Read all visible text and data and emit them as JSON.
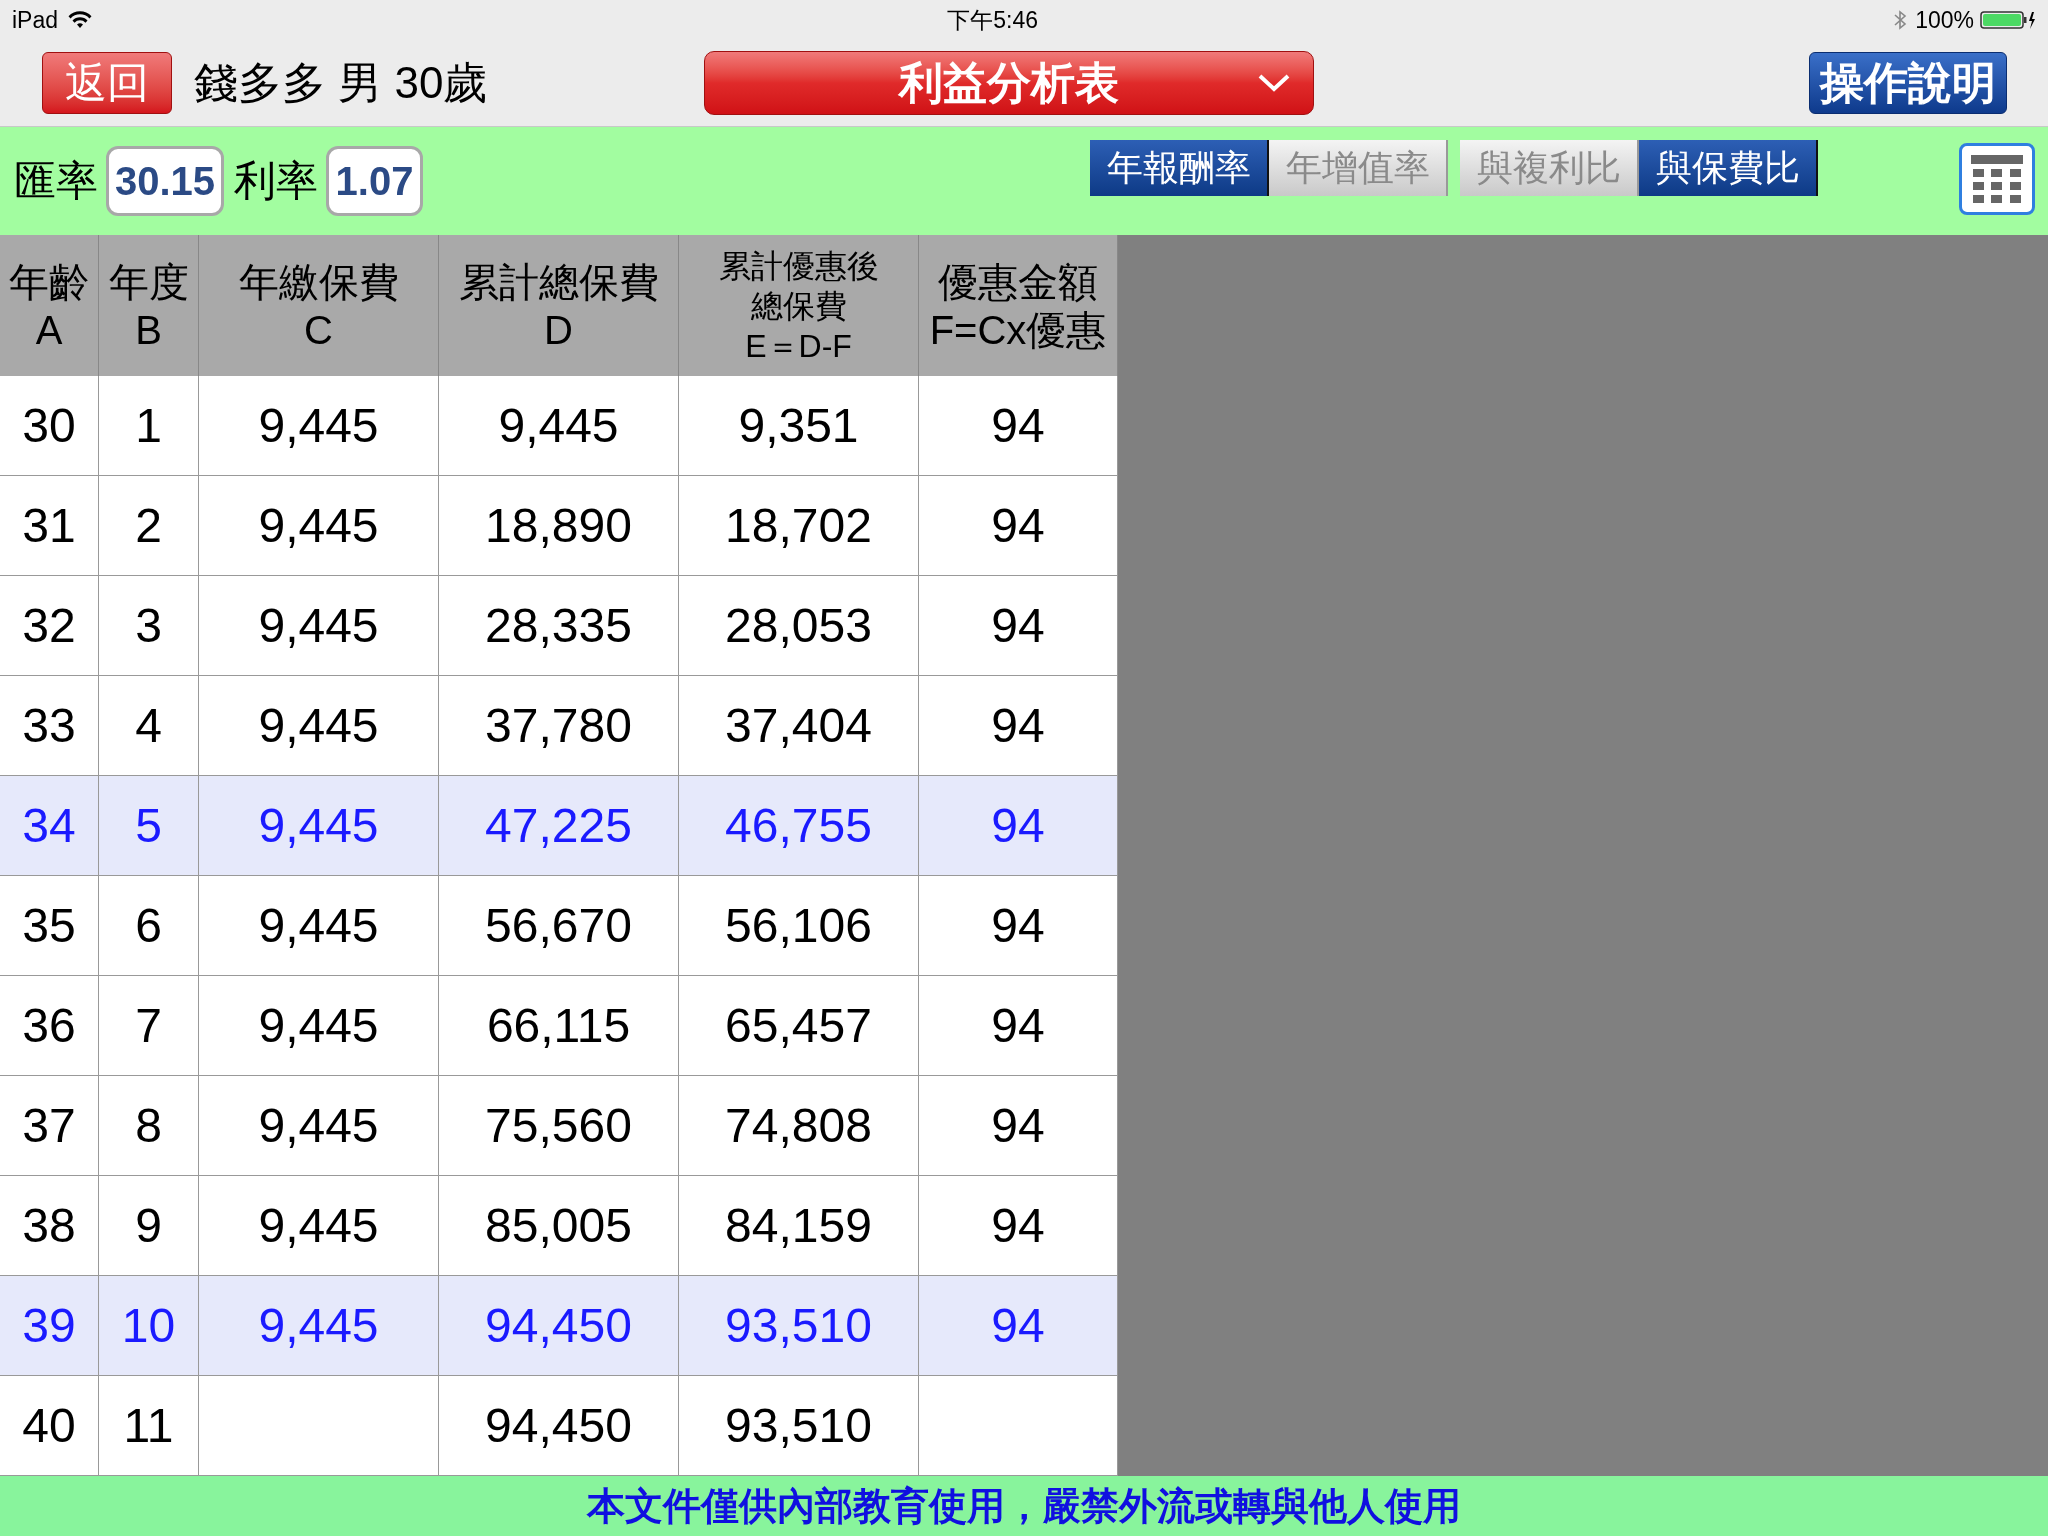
{
  "status_bar": {
    "device": "iPad",
    "time": "下午5:46",
    "battery": "100%"
  },
  "top_bar": {
    "back_button": "返回",
    "client": "錢多多 男 30歲",
    "report_dropdown": "利益分析表",
    "help_button": "操作說明"
  },
  "toolbar": {
    "exchange_rate_label": "匯率",
    "exchange_rate": "30.15",
    "interest_rate_label": "利率",
    "interest_rate": "1.07",
    "toggles": [
      {
        "label": "年報酬率",
        "selected": true
      },
      {
        "label": "年增值率",
        "selected": false
      },
      {
        "label": "與複利比",
        "selected": false
      },
      {
        "label": "與保費比",
        "selected": true
      }
    ]
  },
  "table": {
    "columns": [
      "年齡\nA",
      "年度\nB",
      "年繳保費\nC",
      "累計總保費\nD",
      "累計優惠後總保費\nE＝D-F",
      "優惠金額\nF=Cx優惠"
    ],
    "rows": [
      {
        "highlighted": false,
        "cells": [
          "30",
          "1",
          "9,445",
          "9,445",
          "9,351",
          "94"
        ]
      },
      {
        "highlighted": false,
        "cells": [
          "31",
          "2",
          "9,445",
          "18,890",
          "18,702",
          "94"
        ]
      },
      {
        "highlighted": false,
        "cells": [
          "32",
          "3",
          "9,445",
          "28,335",
          "28,053",
          "94"
        ]
      },
      {
        "highlighted": false,
        "cells": [
          "33",
          "4",
          "9,445",
          "37,780",
          "37,404",
          "94"
        ]
      },
      {
        "highlighted": true,
        "cells": [
          "34",
          "5",
          "9,445",
          "47,225",
          "46,755",
          "94"
        ]
      },
      {
        "highlighted": false,
        "cells": [
          "35",
          "6",
          "9,445",
          "56,670",
          "56,106",
          "94"
        ]
      },
      {
        "highlighted": false,
        "cells": [
          "36",
          "7",
          "9,445",
          "66,115",
          "65,457",
          "94"
        ]
      },
      {
        "highlighted": false,
        "cells": [
          "37",
          "8",
          "9,445",
          "75,560",
          "74,808",
          "94"
        ]
      },
      {
        "highlighted": false,
        "cells": [
          "38",
          "9",
          "9,445",
          "85,005",
          "84,159",
          "94"
        ]
      },
      {
        "highlighted": true,
        "cells": [
          "39",
          "10",
          "9,445",
          "94,450",
          "93,510",
          "94"
        ]
      },
      {
        "highlighted": false,
        "cells": [
          "40",
          "11",
          "",
          "94,450",
          "93,510",
          ""
        ]
      }
    ]
  },
  "footer": "本文件僅供內部教育使用，嚴禁外流或轉與他人使用"
}
